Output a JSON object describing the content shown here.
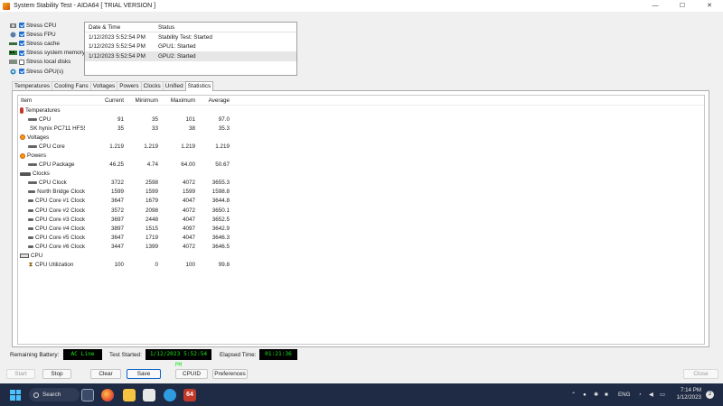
{
  "window": {
    "title": "System Stability Test - AIDA64  [ TRIAL VERSION ]",
    "min": "—",
    "max": "☐",
    "close": "✕"
  },
  "stress_options": [
    {
      "label": "Stress CPU",
      "checked": true,
      "icon": "cpu-icon"
    },
    {
      "label": "Stress FPU",
      "checked": true,
      "icon": "fpu-icon"
    },
    {
      "label": "Stress cache",
      "checked": true,
      "icon": "cache-icon"
    },
    {
      "label": "Stress system memory",
      "checked": true,
      "icon": "memory-icon"
    },
    {
      "label": "Stress local disks",
      "checked": false,
      "icon": "disk-icon"
    },
    {
      "label": "Stress GPU(s)",
      "checked": true,
      "icon": "gpu-icon"
    }
  ],
  "log": {
    "headers": [
      "Date & Time",
      "Status"
    ],
    "rows": [
      [
        "1/12/2023 5:52:54 PM",
        "Stability Test: Started"
      ],
      [
        "1/12/2023 5:52:54 PM",
        "GPU1: Started"
      ],
      [
        "1/12/2023 5:52:54 PM",
        "GPU2: Started"
      ]
    ]
  },
  "tabs": [
    "Temperatures",
    "Cooling Fans",
    "Voltages",
    "Powers",
    "Clocks",
    "Unified",
    "Statistics"
  ],
  "active_tab": "Statistics",
  "stats": {
    "headers": [
      "Item",
      "Current",
      "Minimum",
      "Maximum",
      "Average"
    ],
    "rows": [
      {
        "type": "cat",
        "icon": "therm",
        "label": "Temperatures"
      },
      {
        "type": "sub",
        "icon": "chip",
        "label": "CPU",
        "cur": "91",
        "min": "35",
        "max": "101",
        "avg": "97.0"
      },
      {
        "type": "sub",
        "icon": "ssd",
        "label": "SK hynix PC711 HFS5...",
        "cur": "35",
        "min": "33",
        "max": "38",
        "avg": "35.3"
      },
      {
        "type": "cat",
        "icon": "volt",
        "label": "Voltages"
      },
      {
        "type": "sub",
        "icon": "chip",
        "label": "CPU Core",
        "cur": "1.219",
        "min": "1.219",
        "max": "1.219",
        "avg": "1.219"
      },
      {
        "type": "cat",
        "icon": "volt",
        "label": "Powers"
      },
      {
        "type": "sub",
        "icon": "chip",
        "label": "CPU Package",
        "cur": "46.25",
        "min": "4.74",
        "max": "64.00",
        "avg": "50.67"
      },
      {
        "type": "cat",
        "icon": "chipcat",
        "label": "Clocks"
      },
      {
        "type": "sub",
        "icon": "chip",
        "label": "CPU Clock",
        "cur": "3722",
        "min": "2598",
        "max": "4072",
        "avg": "3655.3"
      },
      {
        "type": "sub",
        "icon": "chip",
        "label": "North Bridge Clock",
        "cur": "1599",
        "min": "1599",
        "max": "1599",
        "avg": "1598.8"
      },
      {
        "type": "sub",
        "icon": "chip",
        "label": "CPU Core #1 Clock",
        "cur": "3647",
        "min": "1679",
        "max": "4047",
        "avg": "3644.8"
      },
      {
        "type": "sub",
        "icon": "chip",
        "label": "CPU Core #2 Clock",
        "cur": "3572",
        "min": "2098",
        "max": "4072",
        "avg": "3650.1"
      },
      {
        "type": "sub",
        "icon": "chip",
        "label": "CPU Core #3 Clock",
        "cur": "3697",
        "min": "2448",
        "max": "4047",
        "avg": "3652.5"
      },
      {
        "type": "sub",
        "icon": "chip",
        "label": "CPU Core #4 Clock",
        "cur": "3897",
        "min": "1515",
        "max": "4097",
        "avg": "3642.9"
      },
      {
        "type": "sub",
        "icon": "chip",
        "label": "CPU Core #5 Clock",
        "cur": "3647",
        "min": "1719",
        "max": "4047",
        "avg": "3646.3"
      },
      {
        "type": "sub",
        "icon": "chip",
        "label": "CPU Core #6 Clock",
        "cur": "3447",
        "min": "1399",
        "max": "4072",
        "avg": "3646.5"
      },
      {
        "type": "cat",
        "icon": "cpu",
        "label": "CPU"
      },
      {
        "type": "sub",
        "icon": "hour",
        "label": "CPU Utilization",
        "cur": "100",
        "min": "0",
        "max": "100",
        "avg": "99.8"
      }
    ]
  },
  "status": {
    "battery_label": "Remaining Battery:",
    "battery_value": "AC Line",
    "started_label": "Test Started:",
    "started_value": "1/12/2023 5:52:54 PM",
    "elapsed_label": "Elapsed Time:",
    "elapsed_value": "01:21:36"
  },
  "buttons": {
    "start": "Start",
    "stop": "Stop",
    "clear": "Clear",
    "save": "Save",
    "cpuid": "CPUID",
    "preferences": "Preferences",
    "close": "Close"
  },
  "taskbar": {
    "search": "Search",
    "lang": "ENG",
    "time": "7:14 PM",
    "date": "1/12/2023",
    "notif_count": "2",
    "aida_label": "64"
  },
  "colors": {
    "status_box_bg": "#000000",
    "status_box_text": "#19e619",
    "checkbox_on": "#1f6fd1",
    "taskbar_bg": "#1f2b44"
  }
}
